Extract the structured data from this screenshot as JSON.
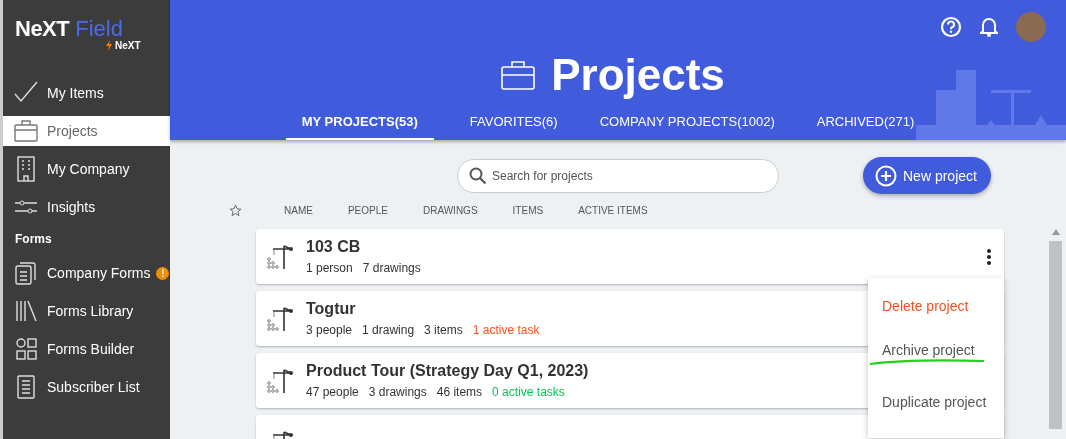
{
  "logo": {
    "brand": "NeXT",
    "product": "Field",
    "sub": "NeXT"
  },
  "sidebar": {
    "items": [
      {
        "label": "My Items",
        "selected": false
      },
      {
        "label": "Projects",
        "selected": true
      },
      {
        "label": "My Company",
        "selected": false
      },
      {
        "label": "Insights",
        "selected": false
      }
    ],
    "section": "Forms",
    "forms_items": [
      {
        "label": "Company Forms",
        "selected": false,
        "badge": "!"
      },
      {
        "label": "Forms Library",
        "selected": false
      },
      {
        "label": "Forms Builder",
        "selected": false
      },
      {
        "label": "Subscriber List",
        "selected": false
      }
    ]
  },
  "header": {
    "title": "Projects",
    "tabs": [
      {
        "label": "MY PROJECTS(53)",
        "selected": true
      },
      {
        "label": "FAVORITES(6)",
        "selected": false
      },
      {
        "label": "COMPANY PROJECTS(1002)",
        "selected": false
      },
      {
        "label": "ARCHIVED(271)",
        "selected": false
      }
    ]
  },
  "search": {
    "placeholder": "Search for projects"
  },
  "new_project_button": "New project",
  "table": {
    "columns": [
      "NAME",
      "PEOPLE",
      "DRAWINGS",
      "ITEMS",
      "ACTIVE ITEMS"
    ],
    "rows": [
      {
        "name": "103 CB",
        "details": [
          {
            "text": "1 person"
          },
          {
            "text": "7 drawings"
          }
        ]
      },
      {
        "name": "Togtur",
        "details": [
          {
            "text": "3 people"
          },
          {
            "text": "1 drawing"
          },
          {
            "text": "3 items"
          },
          {
            "text": "1 active task",
            "color": "#f4511e"
          }
        ]
      },
      {
        "name": "Product Tour (Strategy Day Q1, 2023)",
        "details": [
          {
            "text": "47 people"
          },
          {
            "text": "3 drawings"
          },
          {
            "text": "46 items"
          },
          {
            "text": "0 active tasks",
            "color": "#00c853"
          }
        ]
      },
      {
        "name": "",
        "details": []
      }
    ]
  },
  "context_menu": {
    "items": [
      {
        "label": "Delete project",
        "kind": "danger",
        "marked": false
      },
      {
        "label": "Archive project",
        "kind": "normal",
        "marked": true
      },
      {
        "label": "Duplicate project",
        "kind": "normal",
        "marked": false
      }
    ]
  }
}
